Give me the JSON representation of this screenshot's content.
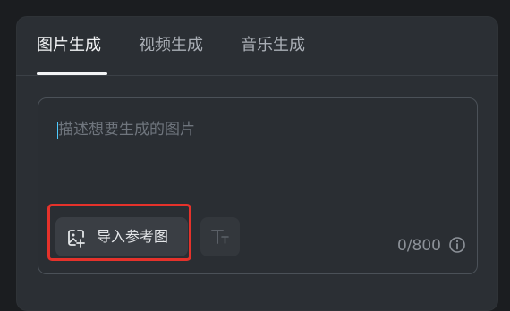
{
  "tabs": [
    {
      "label": "图片生成",
      "active": true
    },
    {
      "label": "视频生成",
      "active": false
    },
    {
      "label": "音乐生成",
      "active": false
    }
  ],
  "prompt": {
    "placeholder": "描述想要生成的图片",
    "value": ""
  },
  "toolbar": {
    "import_label": "导入参考图",
    "import_icon": "image-add-icon",
    "text_icon": "text-style-icon"
  },
  "counter": {
    "text": "0/800",
    "info_icon": "info-icon"
  },
  "colors": {
    "background": "#1b1d20",
    "panel": "#2b2f34",
    "active_tab": "#f2f3f5",
    "inactive_tab": "#a9aeb5",
    "highlight": "#e5322b",
    "caret": "#4ecbff"
  }
}
